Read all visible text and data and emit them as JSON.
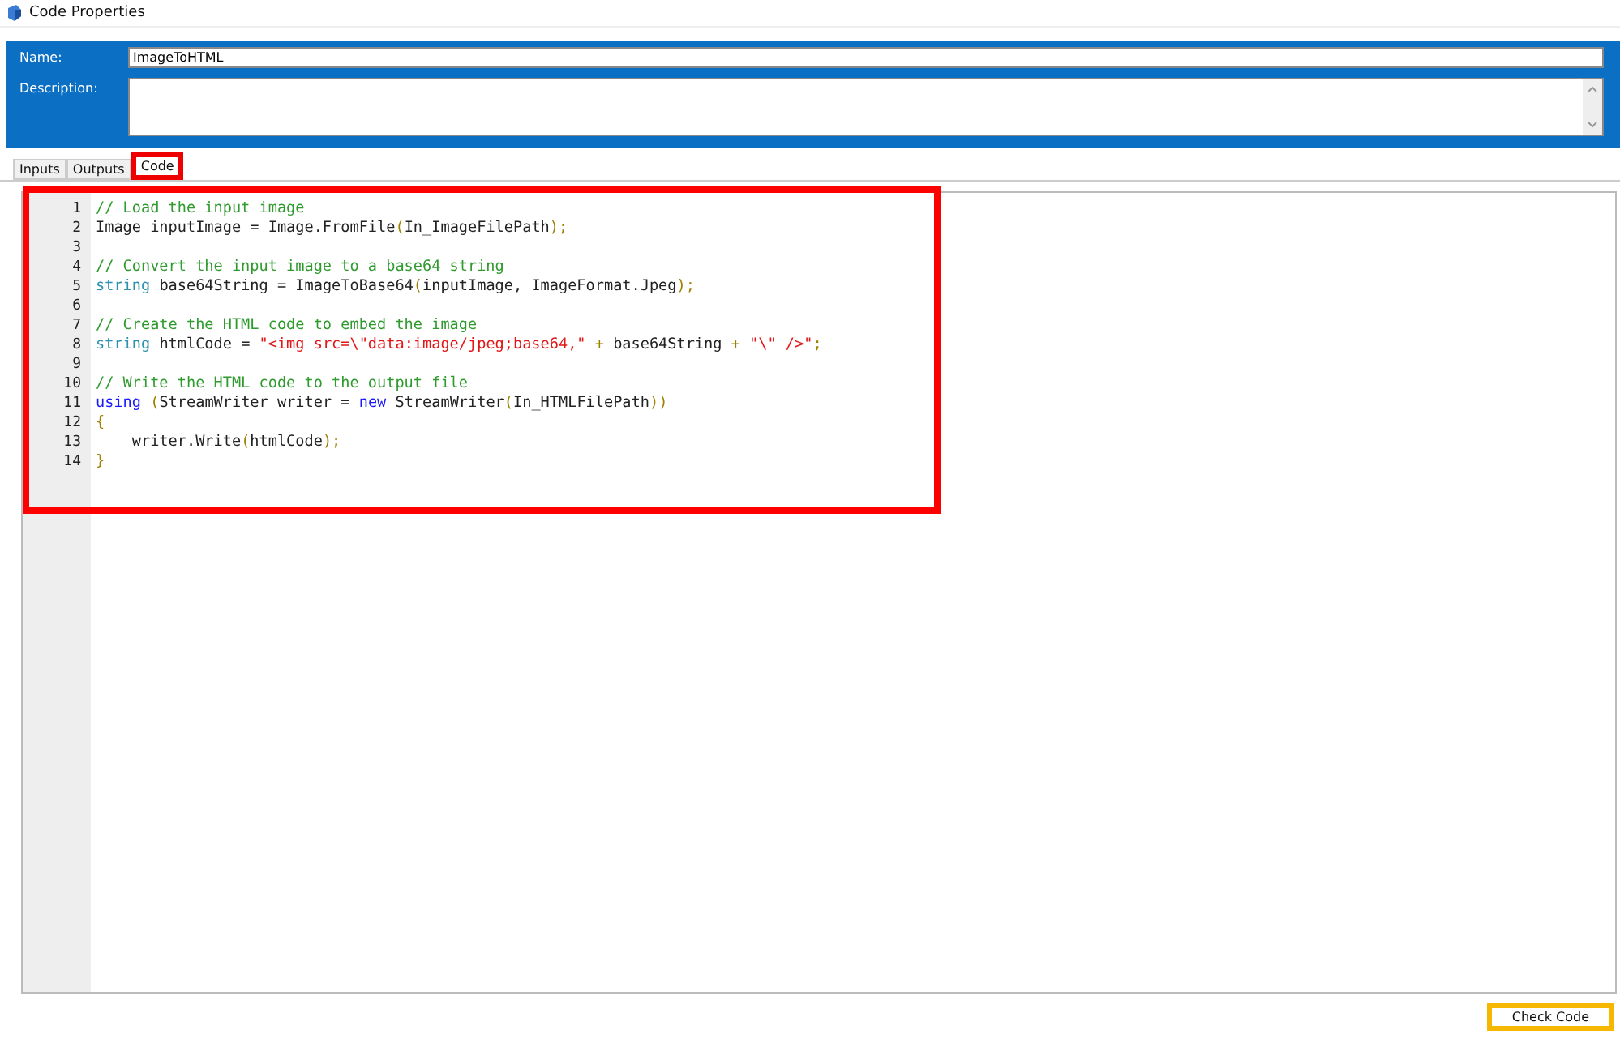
{
  "window": {
    "title": "Code Properties"
  },
  "form": {
    "name_label": "Name:",
    "name_value": "ImageToHTML",
    "description_label": "Description:"
  },
  "tabs": [
    {
      "label": "Inputs",
      "selected": false,
      "highlighted": false
    },
    {
      "label": "Outputs",
      "selected": false,
      "highlighted": false
    },
    {
      "label": "Code",
      "selected": true,
      "highlighted": true
    }
  ],
  "editor": {
    "highlighted": true,
    "lines": [
      {
        "number": "1",
        "tokens": [
          {
            "kind": "comment",
            "text": "// Load the input image"
          }
        ]
      },
      {
        "number": "2",
        "tokens": [
          {
            "kind": "plain",
            "text": "Image inputImage = Image.FromFile"
          },
          {
            "kind": "punct",
            "text": "("
          },
          {
            "kind": "plain",
            "text": "In_ImageFilePath"
          },
          {
            "kind": "punct",
            "text": ");"
          }
        ]
      },
      {
        "number": "3"
      },
      {
        "number": "4",
        "tokens": [
          {
            "kind": "comment",
            "text": "// Convert the input image to a base64 string"
          }
        ]
      },
      {
        "number": "5",
        "tokens": [
          {
            "kind": "type",
            "text": "string"
          },
          {
            "kind": "plain",
            "text": " base64String = ImageToBase64"
          },
          {
            "kind": "punct",
            "text": "("
          },
          {
            "kind": "plain",
            "text": "inputImage, ImageFormat.Jpeg"
          },
          {
            "kind": "punct",
            "text": ");"
          }
        ]
      },
      {
        "number": "6"
      },
      {
        "number": "7",
        "tokens": [
          {
            "kind": "comment",
            "text": "// Create the HTML code to embed the image"
          }
        ]
      },
      {
        "number": "8",
        "tokens": [
          {
            "kind": "type",
            "text": "string"
          },
          {
            "kind": "plain",
            "text": " htmlCode = "
          },
          {
            "kind": "string",
            "text": "\"<img src=\\\"data:image/jpeg;base64,\""
          },
          {
            "kind": "punct",
            "text": " + "
          },
          {
            "kind": "plain",
            "text": "base64String"
          },
          {
            "kind": "punct",
            "text": " + "
          },
          {
            "kind": "string",
            "text": "\"\\\" />\""
          },
          {
            "kind": "punct",
            "text": ";"
          }
        ]
      },
      {
        "number": "9"
      },
      {
        "number": "10",
        "tokens": [
          {
            "kind": "comment",
            "text": "// Write the HTML code to the output file"
          }
        ]
      },
      {
        "number": "11",
        "tokens": [
          {
            "kind": "keyword",
            "text": "using"
          },
          {
            "kind": "punct",
            "text": " ("
          },
          {
            "kind": "plain",
            "text": "StreamWriter writer = "
          },
          {
            "kind": "keyword",
            "text": "new"
          },
          {
            "kind": "plain",
            "text": " StreamWriter"
          },
          {
            "kind": "punct",
            "text": "("
          },
          {
            "kind": "plain",
            "text": "In_HTMLFilePath"
          },
          {
            "kind": "punct",
            "text": "))"
          }
        ]
      },
      {
        "number": "12",
        "tokens": [
          {
            "kind": "punct",
            "text": "{"
          }
        ]
      },
      {
        "number": "13",
        "tokens": [
          {
            "kind": "plain",
            "text": "    writer.Write"
          },
          {
            "kind": "punct",
            "text": "("
          },
          {
            "kind": "plain",
            "text": "htmlCode"
          },
          {
            "kind": "punct",
            "text": ");"
          }
        ]
      },
      {
        "number": "14",
        "tokens": [
          {
            "kind": "punct",
            "text": "}"
          }
        ]
      }
    ]
  },
  "button": {
    "label": "Check Code",
    "highlighted": true
  }
}
